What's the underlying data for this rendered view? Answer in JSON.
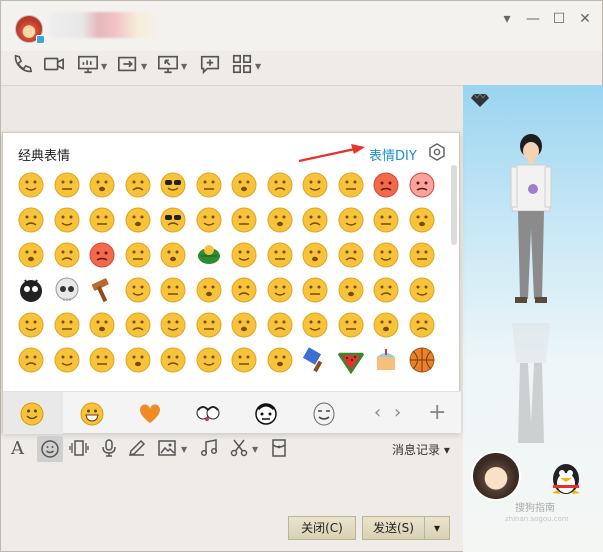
{
  "panel": {
    "title": "经典表情",
    "diy_label": "表情DIY"
  },
  "input_toolbar": {
    "history_label": "消息记录 ▾"
  },
  "buttons": {
    "close_label": "关闭(C)",
    "send_label": "发送(S)"
  },
  "watermark": {
    "line1": "搜狗指南",
    "line2": "zhinan.sogou.com"
  },
  "colors": {
    "accent_link": "#1d8fd6",
    "annotation_arrow": "#e8322c",
    "emoji_yellow": "#f7c33a"
  }
}
